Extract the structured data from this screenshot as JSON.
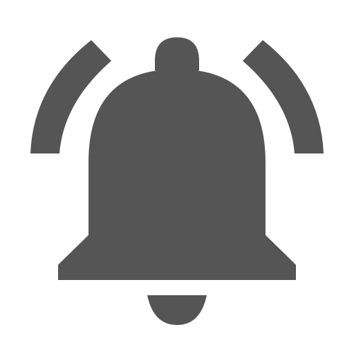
{
  "icon": {
    "name": "notification-bell-ringing-icon",
    "color": "#555555",
    "background": "#ffffff"
  }
}
